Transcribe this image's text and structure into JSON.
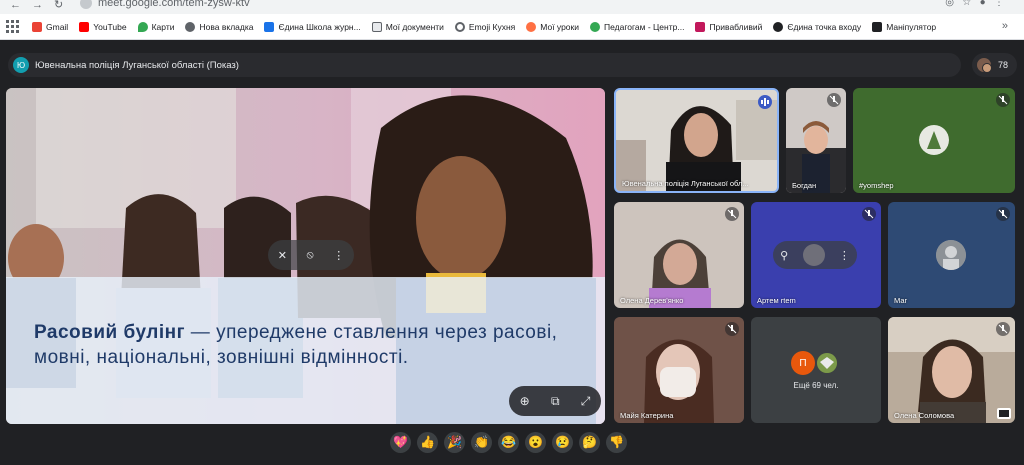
{
  "browser": {
    "url": "meet.google.com/tem-zysw-ktv",
    "bookmarks": [
      {
        "label": "Gmail",
        "color": "#ea4335"
      },
      {
        "label": "YouTube",
        "color": "#ff0000"
      },
      {
        "label": "Карти",
        "color": "#34a853"
      },
      {
        "label": "Нова вкладка",
        "color": "#5f6368"
      },
      {
        "label": "Єдина Школа журн...",
        "color": "#1a73e8"
      },
      {
        "label": "Мої документи",
        "color": "#202124"
      },
      {
        "label": "Emoji Кухня",
        "color": "#5f6368"
      },
      {
        "label": "Мої уроки",
        "color": "#ff7043"
      },
      {
        "label": "Педагогам - Центр...",
        "color": "#34a853"
      },
      {
        "label": "Привабливий",
        "color": "#c2185b"
      },
      {
        "label": "Єдина точка входу",
        "color": "#202124"
      },
      {
        "label": "Маніпулятор",
        "color": "#202124"
      }
    ],
    "more": "»"
  },
  "meeting": {
    "avatar_letter": "Ю",
    "title": "Ювенальна поліція Луганської області (Показ)",
    "participant_count": "78"
  },
  "presentation": {
    "caption_bold": "Расовий булінг",
    "caption_rest": " — упереджене ставлення через расові, мовні, національні, зовнішні відмінності."
  },
  "participants": [
    {
      "name": "Ювенальна поліція Луганської обл...",
      "mic": "speaking"
    },
    {
      "name": "Богдан",
      "mic": "muted"
    },
    {
      "name": "#yomshep",
      "mic": "muted"
    },
    {
      "name": "Олена Дерев'янко",
      "mic": "muted"
    },
    {
      "name": "Артем rtem",
      "mic": "muted"
    },
    {
      "name": "Маг",
      "mic": "muted"
    },
    {
      "name": "Майя Катерина",
      "mic": "muted"
    },
    {
      "name": "Олена Соломова",
      "mic": "muted"
    }
  ],
  "others": {
    "letter": "П",
    "label": "Ещё 69 чел."
  },
  "reactions": [
    "💖",
    "👍",
    "🎉",
    "👏",
    "😂",
    "😮",
    "😢",
    "🤔",
    "👎"
  ]
}
